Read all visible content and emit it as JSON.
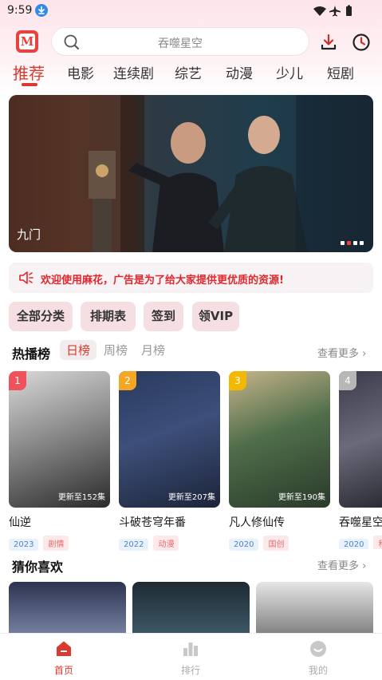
{
  "status_bar": {
    "time": "9:59"
  },
  "header": {
    "search_placeholder": "吞噬星空"
  },
  "tabs": [
    {
      "label": "推荐",
      "active": true
    },
    {
      "label": "电影"
    },
    {
      "label": "连续剧"
    },
    {
      "label": "综艺"
    },
    {
      "label": "动漫"
    },
    {
      "label": "少儿"
    },
    {
      "label": "短剧"
    }
  ],
  "banner": {
    "title": "九门",
    "dot_count": 4,
    "active_dot": 1
  },
  "notice": {
    "text": "欢迎使用麻花，广告是为了给大家提供更优质的资源!"
  },
  "quick_buttons": [
    {
      "label": "全部分类"
    },
    {
      "label": "排期表"
    },
    {
      "label": "签到"
    },
    {
      "label": "领VIP"
    }
  ],
  "hot": {
    "title": "热播榜",
    "tabs": [
      {
        "label": "日榜",
        "active": true
      },
      {
        "label": "周榜"
      },
      {
        "label": "月榜"
      }
    ],
    "more": "查看更多 ›",
    "items": [
      {
        "rank": "1",
        "title": "仙逆",
        "episode": "更新至152集",
        "year": "2023",
        "genre": "剧情"
      },
      {
        "rank": "2",
        "title": "斗破苍穹年番",
        "episode": "更新至207集",
        "year": "2022",
        "genre": "动漫"
      },
      {
        "rank": "3",
        "title": "凡人修仙传",
        "episode": "更新至190集",
        "year": "2020",
        "genre": "国创"
      },
      {
        "rank": "4",
        "title": "吞噬星空",
        "episode": "",
        "year": "2020",
        "genre": "科"
      }
    ]
  },
  "guess": {
    "title": "猜你喜欢",
    "more": "查看更多 ›"
  },
  "bottom_nav": [
    {
      "label": "首页",
      "active": true
    },
    {
      "label": "排行"
    },
    {
      "label": "我的"
    }
  ],
  "colors": {
    "accent": "#d93a2f",
    "notice_red": "#e2262d",
    "rank1": "#f0515a",
    "rank2": "#f5a623",
    "rank3": "#f5b800",
    "rank4": "#b7b7b7"
  }
}
